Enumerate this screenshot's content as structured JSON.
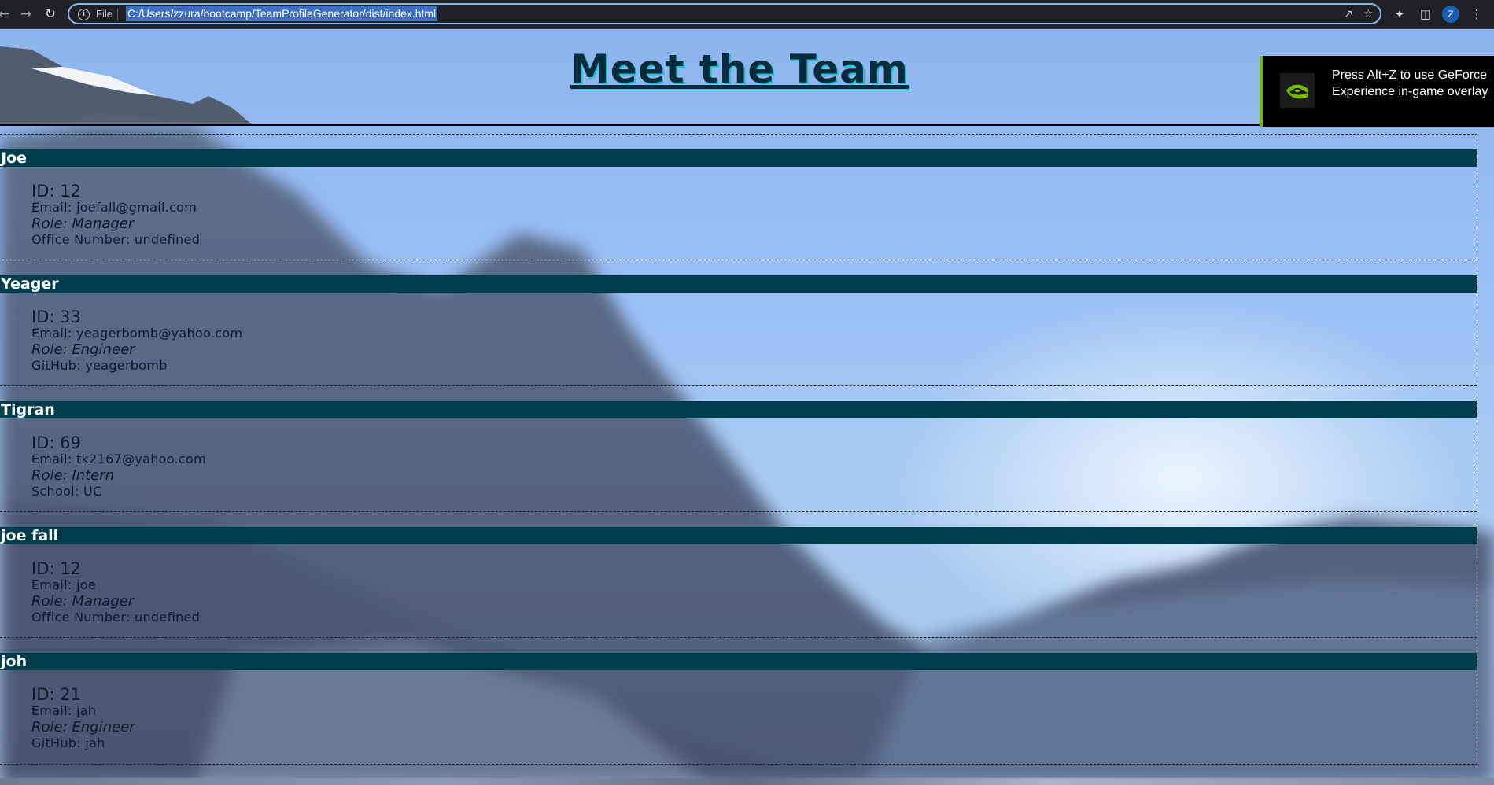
{
  "browser": {
    "scheme_label": "File",
    "url": "C:/Users/zzura/bootcamp/TeamProfileGenerator/dist/index.html",
    "profile_initial": "Z"
  },
  "page": {
    "title": "Meet the Team"
  },
  "team": [
    {
      "name": "Joe",
      "id": "ID: 12",
      "email": "Email: joefall@gmail.com",
      "role": "Role: Manager",
      "extra": "Office Number: undefined"
    },
    {
      "name": "Yeager",
      "id": "ID: 33",
      "email": "Email: yeagerbomb@yahoo.com",
      "role": "Role: Engineer",
      "extra": "GitHub: yeagerbomb"
    },
    {
      "name": "Tigran",
      "id": "ID: 69",
      "email": "Email: tk2167@yahoo.com",
      "role": "Role: Intern",
      "extra": "School: UC"
    },
    {
      "name": "joe fall",
      "id": "ID: 12",
      "email": "Email: joe",
      "role": "Role: Manager",
      "extra": "Office Number: undefined"
    },
    {
      "name": "joh",
      "id": "ID: 21",
      "email": "Email: jah",
      "role": "Role: Engineer",
      "extra": "GitHub: jah"
    }
  ],
  "overlay": {
    "text": "Press Alt+Z to use GeForce Experience in-game overlay"
  },
  "colors": {
    "name_bar": "#003d4d",
    "title_shadow": "#19c3dd",
    "omnibox_focus": "#8ab4f8",
    "nvidia_green": "#76b900"
  },
  "icons": [
    "back-icon",
    "forward-icon",
    "reload-icon",
    "info-icon",
    "share-icon",
    "star-icon",
    "extensions-icon",
    "side-panel-icon",
    "menu-icon",
    "nvidia-icon"
  ]
}
